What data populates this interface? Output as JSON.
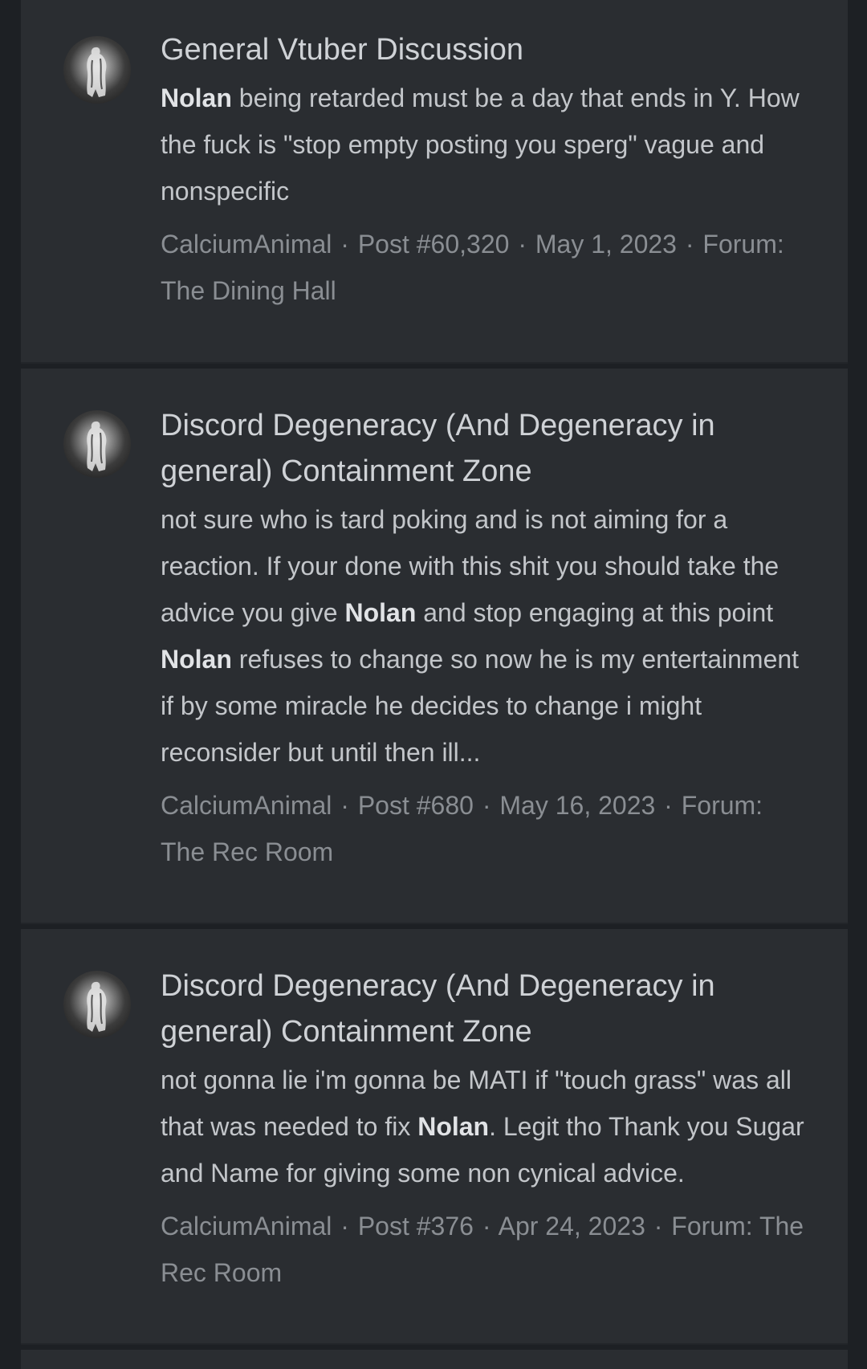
{
  "results": [
    {
      "title": "General Vtuber Discussion",
      "snippet": [
        {
          "text": "Nolan",
          "bold": true
        },
        {
          "text": " being retarded must be a day that ends in Y. How the fuck is \"stop empty posting you sperg\" vague and nonspecific",
          "bold": false
        }
      ],
      "author": "CalciumAnimal",
      "post": "Post #60,320",
      "date": "May 1, 2023",
      "forum_label": "Forum:",
      "forum": "The Dining Hall"
    },
    {
      "title": "Discord Degeneracy (And Degeneracy in general) Containment Zone",
      "snippet": [
        {
          "text": "not sure who is tard poking and is not aiming for a reaction. If your done with this shit you should take the advice you give ",
          "bold": false
        },
        {
          "text": "Nolan",
          "bold": true
        },
        {
          "text": " and stop engaging at this point ",
          "bold": false
        },
        {
          "text": "Nolan",
          "bold": true
        },
        {
          "text": " refuses to change so now he is my entertainment if by some miracle he decides to change i might reconsider but until then ill...",
          "bold": false
        }
      ],
      "author": "CalciumAnimal",
      "post": "Post #680",
      "date": "May 16, 2023",
      "forum_label": "Forum:",
      "forum": "The Rec Room"
    },
    {
      "title": "Discord Degeneracy (And Degeneracy in general) Containment Zone",
      "snippet": [
        {
          "text": "not gonna lie i'm gonna be MATI if \"touch grass\" was all that was needed to fix ",
          "bold": false
        },
        {
          "text": "Nolan",
          "bold": true
        },
        {
          "text": ". Legit tho Thank you Sugar and Name for giving some non cynical advice.",
          "bold": false
        }
      ],
      "author": "CalciumAnimal",
      "post": "Post #376",
      "date": "Apr 24, 2023",
      "forum_label": "Forum:",
      "forum": "The Rec Room"
    }
  ],
  "meta_separator": "·",
  "icons": {
    "avatar": "user-avatar-statue"
  }
}
